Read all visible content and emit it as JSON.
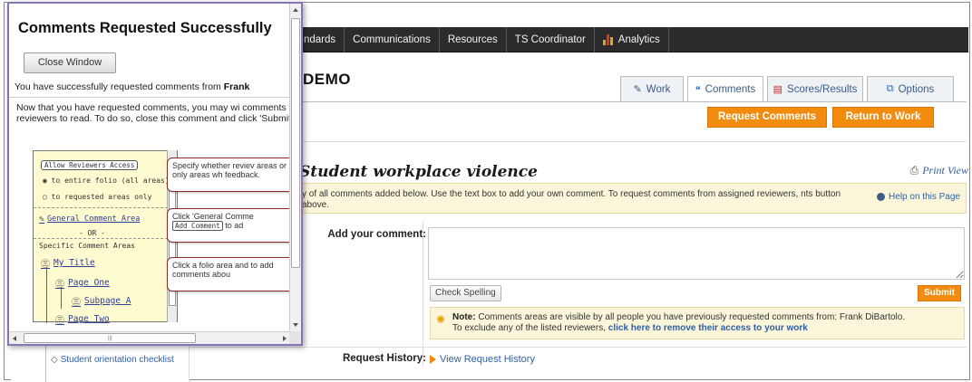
{
  "nav": {
    "items": [
      {
        "label": "ndards"
      },
      {
        "label": "Communications"
      },
      {
        "label": "Resources"
      },
      {
        "label": "TS Coordinator"
      },
      {
        "label": "Analytics"
      }
    ]
  },
  "folio": {
    "title": "DEMO"
  },
  "tabs": {
    "work": "Work",
    "comments": "Comments",
    "scores": "Scores/Results",
    "options": "Options"
  },
  "actions": {
    "request_comments": "Request Comments",
    "return_to_work": "Return to Work"
  },
  "page": {
    "heading": "Student workplace violence",
    "print_view": "Print View",
    "info_text": "y of all comments added below. Use the text box to add your own comment. To request comments from assigned reviewers, nts button above.",
    "help_link": "Help on this Page"
  },
  "form": {
    "add_comment_label": "Add your comment:",
    "comment_value": "",
    "spell_button": "Check Spelling",
    "submit_button": "Submit",
    "note_label": "Note:",
    "note_text": "Comments areas are visible by all people you have previously requested comments from: Frank DiBartolo.",
    "note_text_2": "To exclude any of the listed reviewers,",
    "note_link": "click here to remove their access to your work",
    "history_label": "Request History:",
    "history_link": "View Request History"
  },
  "sidebar": {
    "item": "Student orientation checklist"
  },
  "popup": {
    "title": "Comments Requested Successfully",
    "close_button": "Close Window",
    "success_prefix": "You have successfully requested comments from",
    "success_name": "Frank",
    "instructions": "Now that you have requested comments, you may wi comments for reviewers to read. To do so, close this comment and click 'Submit'.",
    "inner": {
      "allow_button": "Allow Reviewers Access",
      "radio_all": "to entire folio (all areas)",
      "radio_requested": "to requested areas only",
      "general_area": "General Comment Area",
      "or": "- OR -",
      "specific": "Specific Comment Areas",
      "tree": [
        "My Title",
        "Page One",
        "Subpage A",
        "Page Two"
      ],
      "callout_1": "Specify whether reviev areas or only areas wh feedback.",
      "callout_2_a": "Click 'General Comme",
      "callout_2_btn": "Add Comment",
      "callout_2_b": "to ad",
      "callout_3": "Click a folio area and to add comments abou"
    }
  },
  "colors": {
    "nav_bg": "#2b2b2b",
    "accent_orange": "#f28c0f",
    "link_blue": "#2f5fa7",
    "note_bg": "#fbf6da",
    "popup_border": "#8a74b8"
  }
}
